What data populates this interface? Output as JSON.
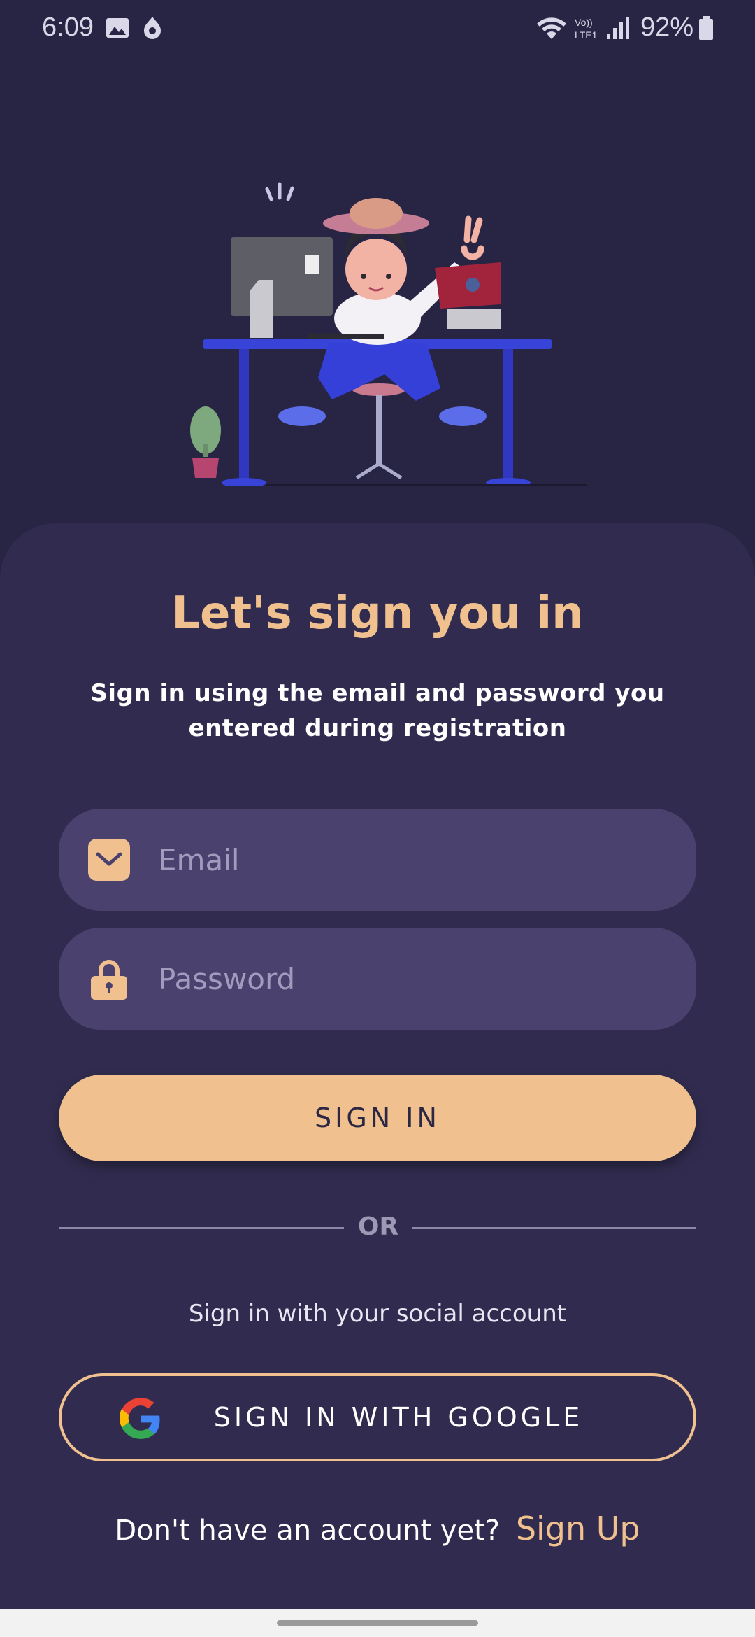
{
  "status_bar": {
    "time": "6:09",
    "battery_percent": "92%",
    "icons": [
      "image-icon",
      "app-notification-icon",
      "wifi-icon",
      "volte-icon",
      "signal-icon",
      "battery-icon"
    ]
  },
  "illustration": {
    "icon": "person-at-desk-illustration"
  },
  "signin": {
    "title": "Let's sign you in",
    "subtitle": "Sign in using the email and password you entered during registration",
    "email_placeholder": "Email",
    "password_placeholder": "Password",
    "button_label": "SIGN IN",
    "divider_text": "OR",
    "social_text": "Sign in with your social account",
    "google_button_label": "SIGN IN WITH GOOGLE",
    "no_account_text": "Don't have an account yet?",
    "signup_link": "Sign Up"
  },
  "colors": {
    "background": "#282544",
    "card": "#312c4f",
    "field": "#4a416e",
    "accent": "#f0c18e"
  }
}
